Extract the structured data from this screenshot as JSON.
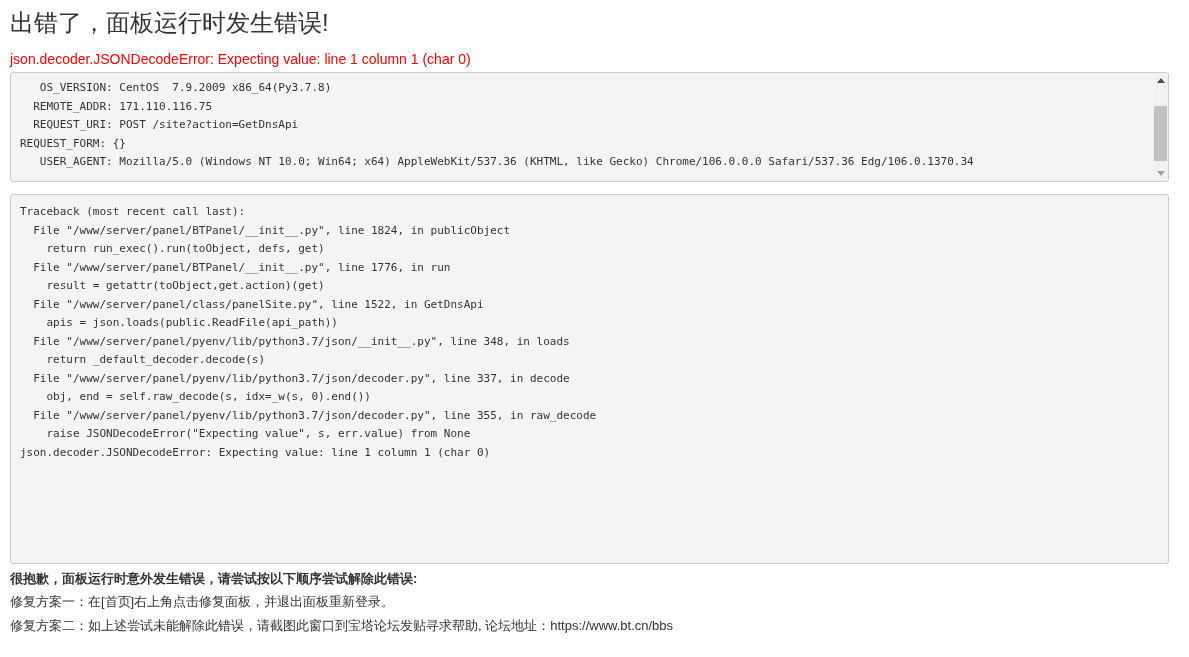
{
  "title": "出错了，面板运行时发生错误!",
  "error_message": "json.decoder.JSONDecodeError: Expecting value: line 1 column 1 (char 0)",
  "environment_lines": [
    "   OS_VERSION: CentOS  7.9.2009 x86_64(Py3.7.8)",
    "  REMOTE_ADDR: 171.110.116.75",
    "  REQUEST_URI: POST /site?action=GetDnsApi",
    "REQUEST_FORM: {}",
    "   USER_AGENT: Mozilla/5.0 (Windows NT 10.0; Win64; x64) AppleWebKit/537.36 (KHTML, like Gecko) Chrome/106.0.0.0 Safari/537.36 Edg/106.0.1370.34"
  ],
  "traceback_lines": [
    "Traceback (most recent call last):",
    "  File \"/www/server/panel/BTPanel/__init__.py\", line 1824, in publicObject",
    "    return run_exec().run(toObject, defs, get)",
    "  File \"/www/server/panel/BTPanel/__init__.py\", line 1776, in run",
    "    result = getattr(toObject,get.action)(get)",
    "  File \"/www/server/panel/class/panelSite.py\", line 1522, in GetDnsApi",
    "    apis = json.loads(public.ReadFile(api_path))",
    "  File \"/www/server/panel/pyenv/lib/python3.7/json/__init__.py\", line 348, in loads",
    "    return _default_decoder.decode(s)",
    "  File \"/www/server/panel/pyenv/lib/python3.7/json/decoder.py\", line 337, in decode",
    "    obj, end = self.raw_decode(s, idx=_w(s, 0).end())",
    "  File \"/www/server/panel/pyenv/lib/python3.7/json/decoder.py\", line 355, in raw_decode",
    "    raise JSONDecodeError(\"Expecting value\", s, err.value) from None",
    "json.decoder.JSONDecodeError: Expecting value: line 1 column 1 (char 0)"
  ],
  "help": {
    "heading": "很抱歉，面板运行时意外发生错误，请尝试按以下顺序尝试解除此错误:",
    "steps": [
      "修复方案一：在[首页]右上角点击修复面板，并退出面板重新登录。",
      "修复方案二：如上述尝试未能解除此错误，请截图此窗口到宝塔论坛发贴寻求帮助, 论坛地址：https://www.bt.cn/bbs"
    ]
  }
}
